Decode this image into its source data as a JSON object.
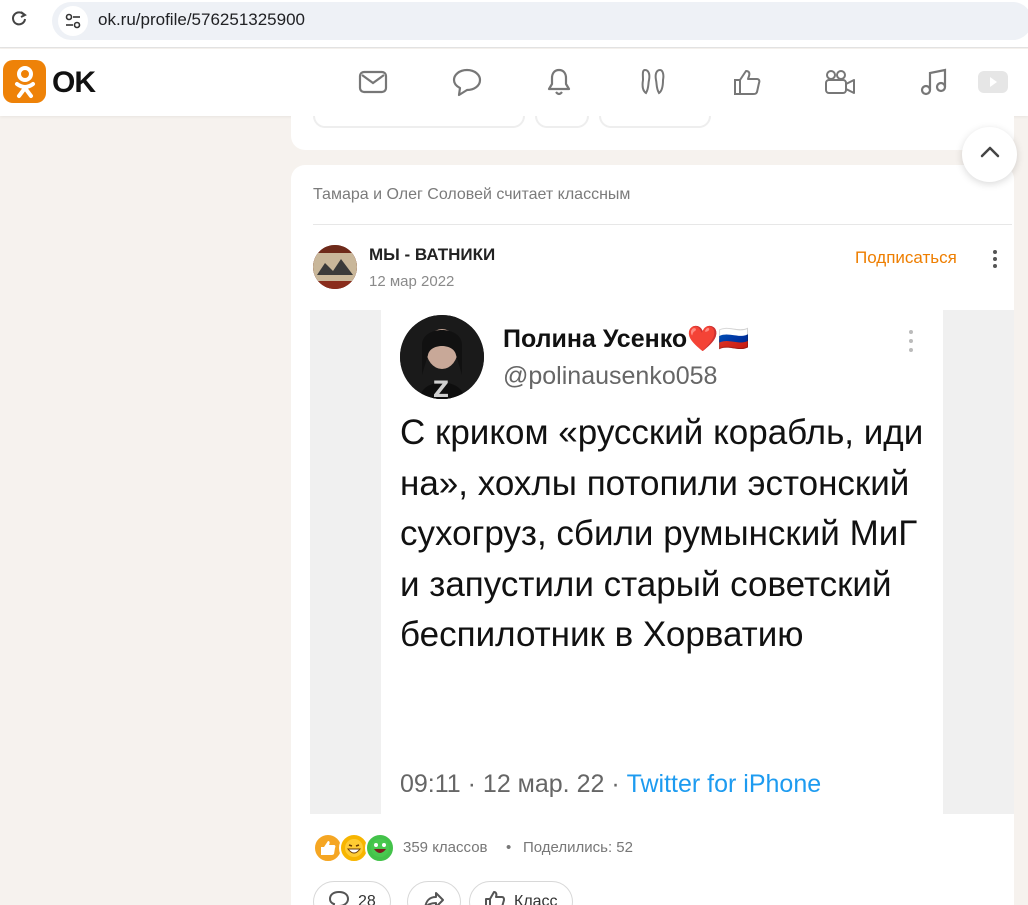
{
  "browser": {
    "url": "ok.ru/profile/576251325900"
  },
  "header": {
    "logo_text": "OK",
    "nav_icons": [
      "mail-icon",
      "chat-icon",
      "bell-icon",
      "guests-icon",
      "like-icon",
      "video-icon",
      "music-icon",
      "vk-video-icon"
    ],
    "accent_color": "#ee8208"
  },
  "post": {
    "activity": "Тамара и Олег Соловей считает классным",
    "group_name": "МЫ - ВАТНИКИ",
    "date": "12 мар 2022",
    "subscribe_label": "Подписаться",
    "tweet": {
      "author": "Полина Усенко❤️🇷🇺",
      "handle": "@polinausenko058",
      "text": "С криком «русский корабль, иди на», хохлы потопили эстонский сухогруз, сбили румынский МиГ и запустили старый советский беспилотник в Хорватию",
      "time": "09:11 · 12 мар. 22 · ",
      "source": "Twitter for iPhone"
    },
    "stats": {
      "classes": "359 классов",
      "separator": "•",
      "shared": "Поделились: 52"
    },
    "actions": {
      "comments": "28",
      "class_label": "Класс"
    }
  }
}
